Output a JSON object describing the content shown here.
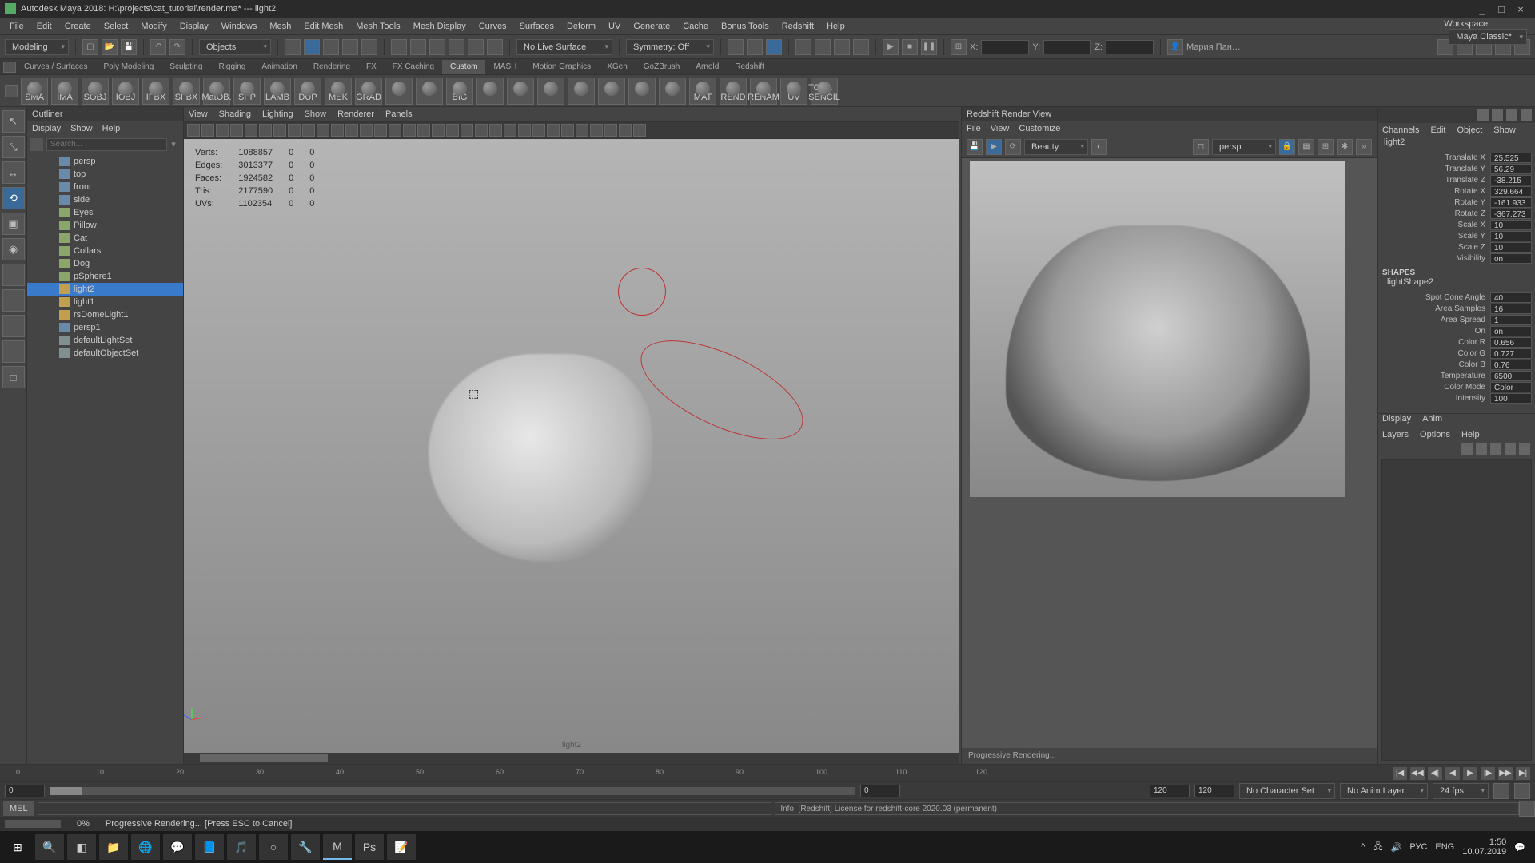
{
  "window": {
    "title": "Autodesk Maya 2018: H:\\projects\\cat_tutorial\\render.ma*   ---   light2",
    "workspace_label": "Workspace:",
    "workspace_value": "Maya Classic*",
    "min": "_",
    "max": "□",
    "close": "×"
  },
  "menubar": [
    "File",
    "Edit",
    "Create",
    "Select",
    "Modify",
    "Display",
    "Windows",
    "Mesh",
    "Edit Mesh",
    "Mesh Tools",
    "Mesh Display",
    "Curves",
    "Surfaces",
    "Deform",
    "UV",
    "Generate",
    "Cache",
    "Bonus Tools",
    "Redshift",
    "Help"
  ],
  "toolbar1": {
    "mode": "Modeling",
    "objects": "Objects",
    "live": "No Live Surface",
    "symmetry": "Symmetry: Off",
    "coord_labels": [
      "X:",
      "Y:",
      "Z:"
    ],
    "user": "Мария Пан…"
  },
  "shelf_tabs": [
    "Curves / Surfaces",
    "Poly Modeling",
    "Sculpting",
    "Rigging",
    "Animation",
    "Rendering",
    "FX",
    "FX Caching",
    "Custom",
    "MASH",
    "Motion Graphics",
    "XGen",
    "GoZBrush",
    "Arnold",
    "Redshift"
  ],
  "shelf_active": "Custom",
  "shelf_icons": [
    "SMA",
    "IMA",
    "SOBJ",
    "IOBJ",
    "IFBX",
    "SFBX",
    "MatOB.",
    "SPP",
    "LAMB",
    "DUP",
    "MEK",
    "GRAD",
    "",
    "",
    "BIG",
    "",
    "",
    "",
    "",
    "",
    "",
    "",
    "MAT",
    "REND",
    "RENAM",
    "UV",
    "TOOL SENCIL"
  ],
  "left_tools": [
    "↖",
    "⤡",
    "↔",
    "⟲",
    "▣",
    "◉",
    "",
    "",
    "",
    "",
    "□"
  ],
  "left_tool_sel_index": 3,
  "outliner": {
    "title": "Outliner",
    "menus": [
      "Display",
      "Show",
      "Help"
    ],
    "search_ph": "Search...",
    "nodes": [
      {
        "label": "persp",
        "type": "cam"
      },
      {
        "label": "top",
        "type": "cam"
      },
      {
        "label": "front",
        "type": "cam"
      },
      {
        "label": "side",
        "type": "cam"
      },
      {
        "label": "Eyes",
        "type": "mesh"
      },
      {
        "label": "Pillow",
        "type": "mesh"
      },
      {
        "label": "Cat",
        "type": "mesh"
      },
      {
        "label": "Collars",
        "type": "mesh"
      },
      {
        "label": "Dog",
        "type": "mesh"
      },
      {
        "label": "pSphere1",
        "type": "mesh"
      },
      {
        "label": "light2",
        "type": "light",
        "selected": true
      },
      {
        "label": "light1",
        "type": "light"
      },
      {
        "label": "rsDomeLight1",
        "type": "light"
      },
      {
        "label": "persp1",
        "type": "cam"
      },
      {
        "label": "defaultLightSet",
        "type": "set"
      },
      {
        "label": "defaultObjectSet",
        "type": "set"
      }
    ]
  },
  "viewport": {
    "menus": [
      "View",
      "Shading",
      "Lighting",
      "Show",
      "Renderer",
      "Panels"
    ],
    "hud": {
      "rows": [
        [
          "Verts:",
          "1088857",
          "0",
          "0"
        ],
        [
          "Edges:",
          "3013377",
          "0",
          "0"
        ],
        [
          "Faces:",
          "1924582",
          "0",
          "0"
        ],
        [
          "Tris:",
          "2177590",
          "0",
          "0"
        ],
        [
          "UVs:",
          "1102354",
          "0",
          "0"
        ]
      ]
    },
    "caption": "light2"
  },
  "renderview": {
    "title": "Redshift Render View",
    "menus": [
      "File",
      "View",
      "Customize"
    ],
    "aov": "Beauty",
    "camera": "persp",
    "status": "Progressive Rendering..."
  },
  "channels": {
    "tabs": [
      "Channels",
      "Edit",
      "Object",
      "Show"
    ],
    "selected_node": "light2",
    "attrs": [
      {
        "l": "Translate X",
        "v": "25.525"
      },
      {
        "l": "Translate Y",
        "v": "56.29"
      },
      {
        "l": "Translate Z",
        "v": "-38.215"
      },
      {
        "l": "Rotate X",
        "v": "329.664"
      },
      {
        "l": "Rotate Y",
        "v": "-161.933"
      },
      {
        "l": "Rotate Z",
        "v": "-367.273"
      },
      {
        "l": "Scale X",
        "v": "10"
      },
      {
        "l": "Scale Y",
        "v": "10"
      },
      {
        "l": "Scale Z",
        "v": "10"
      },
      {
        "l": "Visibility",
        "v": "on"
      }
    ],
    "shapes_heading": "SHAPES",
    "shape_name": "lightShape2",
    "shape_attrs": [
      {
        "l": "Spot Cone Angle",
        "v": "40"
      },
      {
        "l": "Area Samples",
        "v": "16"
      },
      {
        "l": "Area Spread",
        "v": "1"
      },
      {
        "l": "On",
        "v": "on"
      },
      {
        "l": "Color R",
        "v": "0.656"
      },
      {
        "l": "Color G",
        "v": "0.727"
      },
      {
        "l": "Color B",
        "v": "0.76"
      },
      {
        "l": "Temperature",
        "v": "6500"
      },
      {
        "l": "Color Mode",
        "v": "Color"
      },
      {
        "l": "Intensity",
        "v": "100"
      }
    ],
    "tabs2": [
      "Display",
      "Anim"
    ],
    "tabs3": [
      "Layers",
      "Options",
      "Help"
    ]
  },
  "timeline": {
    "ticks": [
      "0",
      "10",
      "20",
      "30",
      "40",
      "50",
      "60",
      "70",
      "80",
      "90",
      "100",
      "110",
      "120"
    ],
    "cur": "0",
    "playback": [
      "|◀",
      "◀◀",
      "◀|",
      "◀",
      "▶",
      "|▶",
      "▶▶",
      "▶|"
    ]
  },
  "range": {
    "start_out": "0",
    "start_in": "0",
    "end_in": "120",
    "end_out": "120",
    "char_set": "No Character Set",
    "anim_layer": "No Anim Layer",
    "fps": "24 fps"
  },
  "cmd": {
    "lang": "MEL",
    "info": "Info: [Redshift] License for redshift-core 2020.03 (permanent)"
  },
  "statusbar": {
    "pct": "0%",
    "msg": "Progressive Rendering... [Press ESC to Cancel]"
  },
  "taskbar": {
    "icons": [
      "⊞",
      "🔍",
      "◧",
      "📁",
      "🌐",
      "💬",
      "📘",
      "🎵",
      "○",
      "🔧",
      "M",
      "Ps",
      "📝"
    ],
    "tray": {
      "lang1": "РУС",
      "lang2": "ENG",
      "time": "1:50",
      "date": "10.07.2019"
    }
  }
}
